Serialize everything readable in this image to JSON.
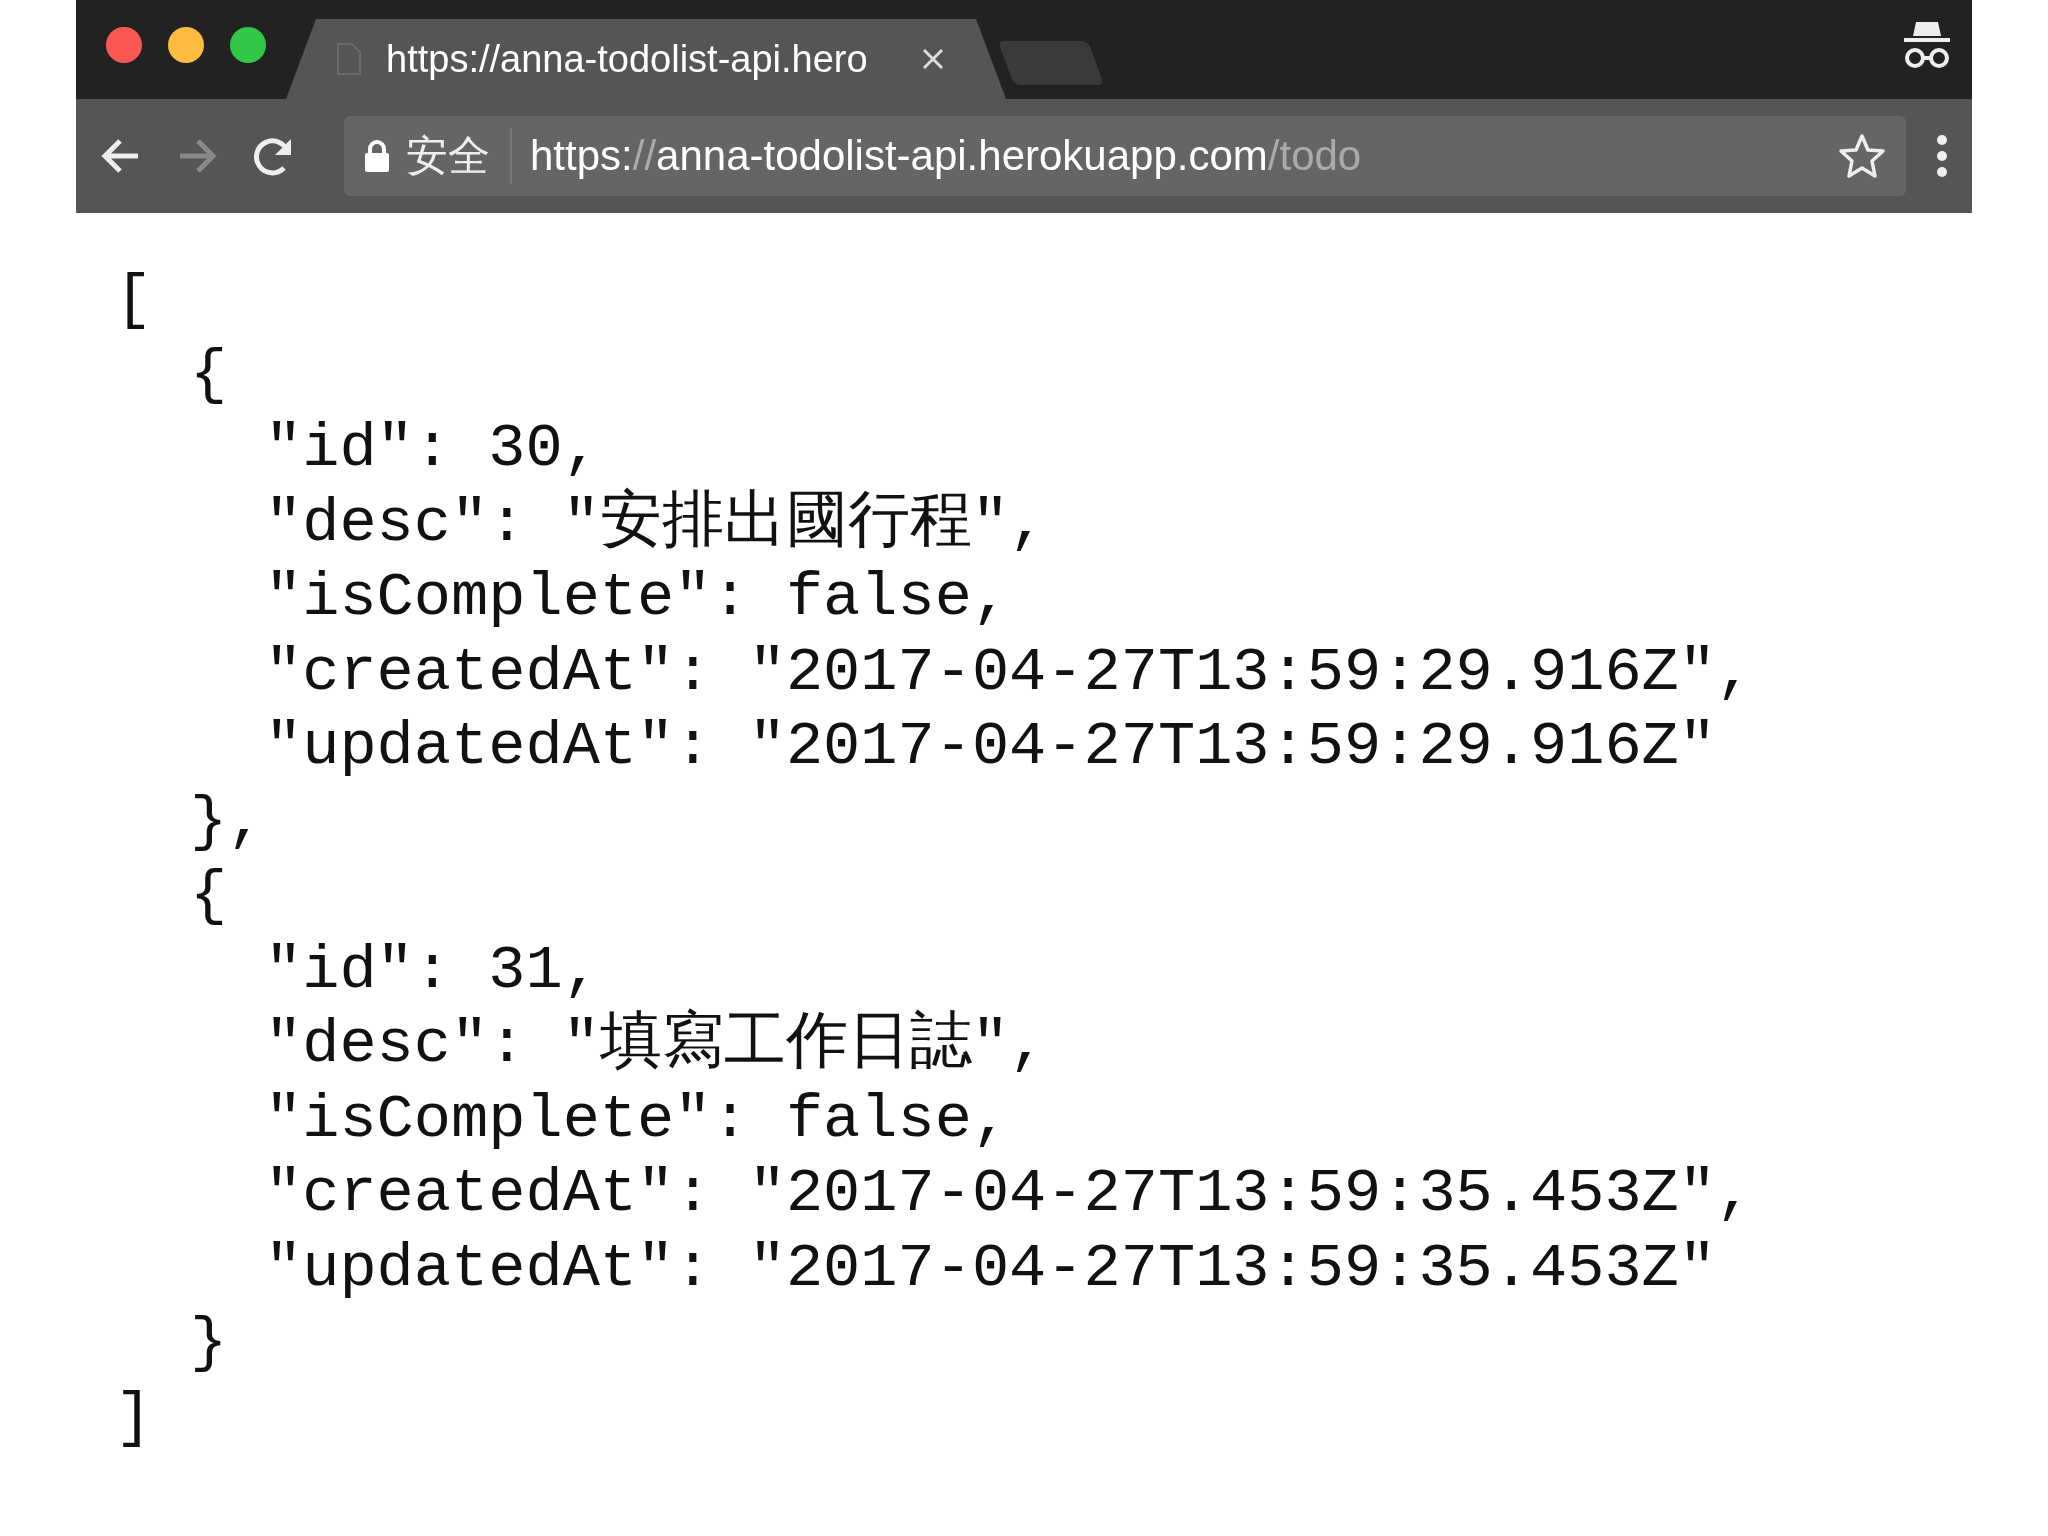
{
  "tab": {
    "title": "https://anna-todolist-api.hero",
    "selected": true
  },
  "address_bar": {
    "security_label": "安全",
    "url_scheme": "https:",
    "url_separator": "//",
    "url_host": "anna-todolist-api.herokuapp.com",
    "url_path": "/todo"
  },
  "document": {
    "open": "[",
    "close": "]",
    "children": [
      {
        "open": "{",
        "close": "},",
        "children": [
          {
            "line": "\"id\": 30,"
          },
          {
            "line": "\"desc\": \"安排出國行程\","
          },
          {
            "line": "\"isComplete\": false,"
          },
          {
            "line": "\"createdAt\": \"2017-04-27T13:59:29.916Z\","
          },
          {
            "line": "\"updatedAt\": \"2017-04-27T13:59:29.916Z\""
          }
        ]
      },
      {
        "open": "{",
        "close": "}",
        "children": [
          {
            "line": "\"id\": 31,"
          },
          {
            "line": "\"desc\": \"填寫工作日誌\","
          },
          {
            "line": "\"isComplete\": false,"
          },
          {
            "line": "\"createdAt\": \"2017-04-27T13:59:35.453Z\","
          },
          {
            "line": "\"updatedAt\": \"2017-04-27T13:59:35.453Z\""
          }
        ]
      }
    ]
  }
}
